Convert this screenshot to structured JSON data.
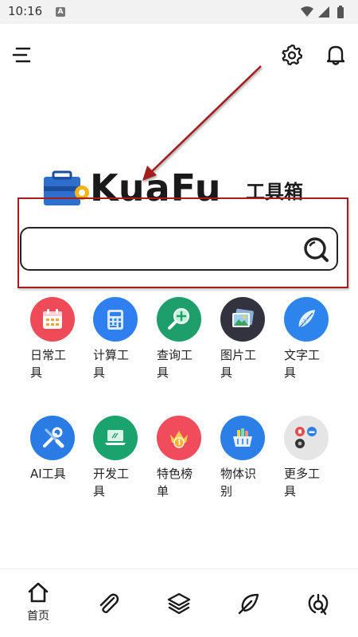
{
  "status_bar": {
    "time": "10:16",
    "notification_badge": "A",
    "icons": [
      "wifi-icon",
      "signal-icon",
      "battery-icon"
    ]
  },
  "header": {
    "menu_icon": "menu-icon",
    "settings_icon": "gear-icon",
    "notification_icon": "bell-icon"
  },
  "logo": {
    "brand": "KuaFu",
    "subtitle": "工具箱"
  },
  "search": {
    "value": "",
    "placeholder": ""
  },
  "tools": [
    {
      "label": "日常工具",
      "icon": "calendar-icon",
      "color": "#ef4a57"
    },
    {
      "label": "计算工具",
      "icon": "calculator-icon",
      "color": "#2f7ff0"
    },
    {
      "label": "查询工具",
      "icon": "magnifier-plus-icon",
      "color": "#1d9e6a"
    },
    {
      "label": "图片工具",
      "icon": "picture-icon",
      "color": "#333340"
    },
    {
      "label": "文字工具",
      "icon": "feather-icon",
      "color": "#2d84ec"
    },
    {
      "label": "AI工具",
      "icon": "wrench-screwdriver-icon",
      "color": "#2a7be4"
    },
    {
      "label": "开发工具",
      "icon": "laptop-icon",
      "color": "#1aa36c"
    },
    {
      "label": "特色榜单",
      "icon": "crown-badge-icon",
      "color": "#f04c5b"
    },
    {
      "label": "物体识别",
      "icon": "basket-icon",
      "color": "#2d7fe8"
    },
    {
      "label": "更多工具",
      "icon": "more-apps-icon",
      "color": "#e5e5e5"
    }
  ],
  "bottom_nav": [
    {
      "label": "首页",
      "icon": "home-icon"
    },
    {
      "label": "",
      "icon": "paperclip-icon"
    },
    {
      "label": "",
      "icon": "layers-icon"
    },
    {
      "label": "",
      "icon": "leaf-icon"
    },
    {
      "label": "",
      "icon": "tools-settings-icon"
    }
  ],
  "colors": {
    "annotation_red": "#a51d1d",
    "text": "#222222"
  }
}
